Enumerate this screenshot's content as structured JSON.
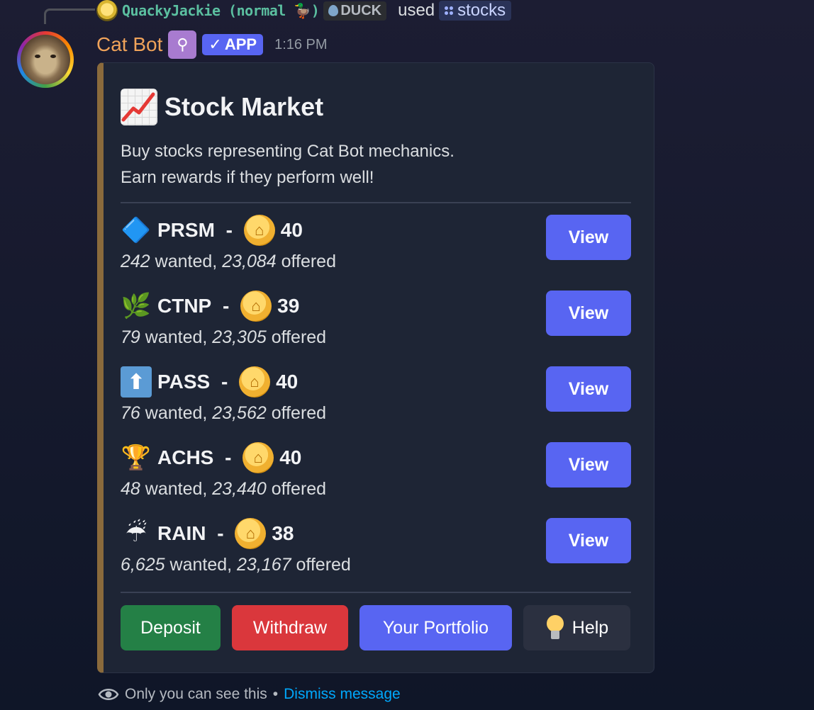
{
  "reply": {
    "username": "QuackyJackie (normal 🦆)",
    "tag": "DUCK",
    "used_text": "used",
    "command": "stocks"
  },
  "message": {
    "author": "Cat Bot",
    "badge": "APP",
    "timestamp": "1:16 PM"
  },
  "embed": {
    "title": "Stock Market",
    "description_lines": [
      "Buy stocks representing Cat Bot mechanics.",
      "Earn rewards if they perform well!"
    ],
    "stocks": [
      {
        "symbol": "PRSM",
        "price": "40",
        "wanted": "242",
        "offered": "23,084",
        "emoji": "prism-icon"
      },
      {
        "symbol": "CTNP",
        "price": "39",
        "wanted": "79",
        "offered": "23,305",
        "emoji": "catnip-icon"
      },
      {
        "symbol": "PASS",
        "price": "40",
        "wanted": "76",
        "offered": "23,562",
        "emoji": "up-arrow-icon"
      },
      {
        "symbol": "ACHS",
        "price": "40",
        "wanted": "48",
        "offered": "23,440",
        "emoji": "trophy-icon"
      },
      {
        "symbol": "RAIN",
        "price": "38",
        "wanted": "6,625",
        "offered": "23,167",
        "emoji": "umbrella-rain-icon"
      }
    ],
    "separator": " - ",
    "wanted_label": "wanted,",
    "offered_label": "offered",
    "view_label": "View"
  },
  "buttons": {
    "deposit": "Deposit",
    "withdraw": "Withdraw",
    "portfolio": "Your Portfolio",
    "help": "Help"
  },
  "footer": {
    "text": "Only you can see this",
    "bullet": "•",
    "dismiss": "Dismiss message"
  },
  "colors": {
    "accent": "#5865f2",
    "deposit": "#248046",
    "withdraw": "#da373c",
    "author": "#f0a35a",
    "embed_border": "#8a6a3c"
  }
}
